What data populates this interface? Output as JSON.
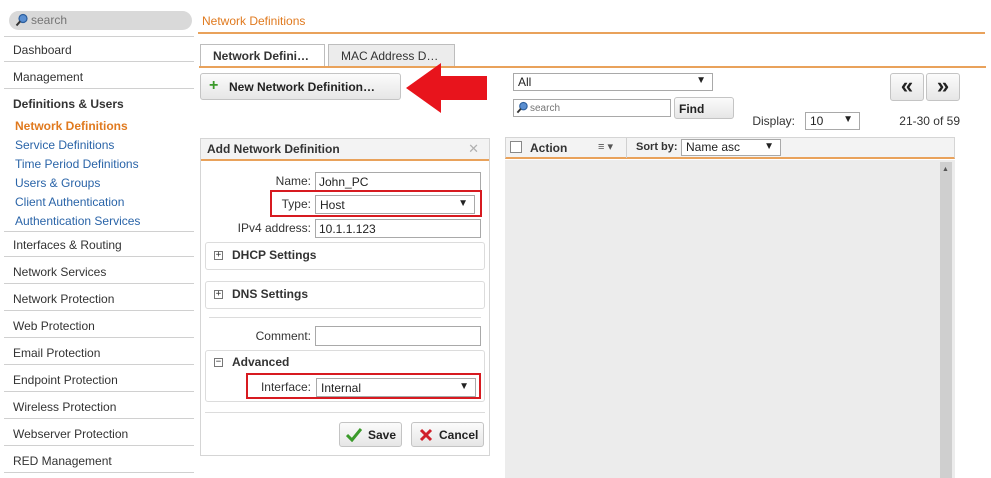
{
  "search": {
    "placeholder": "search"
  },
  "header": {
    "title": "Network Definitions"
  },
  "sidebar": {
    "dashboard": "Dashboard",
    "management": "Management",
    "definitions_users": "Definitions & Users",
    "sub_items": [
      "Network Definitions",
      "Service Definitions",
      "Time Period Definitions",
      "Users & Groups",
      "Client Authentication",
      "Authentication Services"
    ],
    "items": [
      "Interfaces & Routing",
      "Network Services",
      "Network Protection",
      "Web Protection",
      "Email Protection",
      "Endpoint Protection",
      "Wireless Protection",
      "Webserver Protection",
      "RED Management"
    ]
  },
  "tabs": [
    "Network Defini…",
    "MAC Address D…"
  ],
  "toolbar": {
    "new_button": "New Network Definition…",
    "new_icon": "plus-icon",
    "arrow_color": "#e8141c"
  },
  "filter": {
    "selected": "All",
    "search_placeholder": "search",
    "find_label": "Find",
    "display_label": "Display:",
    "display_value": "10",
    "range": "21-30 of 59",
    "prev": "«",
    "next": "»"
  },
  "form": {
    "title": "Add Network Definition",
    "name_label": "Name:",
    "name_value": "John_PC",
    "type_label": "Type:",
    "type_value": "Host",
    "ipv4_label": "IPv4 address:",
    "ipv4_value": "10.1.1.123",
    "dhcp_title": "DHCP Settings",
    "dns_title": "DNS Settings",
    "comment_label": "Comment:",
    "comment_value": "",
    "advanced_title": "Advanced",
    "interface_label": "Interface:",
    "interface_value": "Internal",
    "save_label": "Save",
    "cancel_label": "Cancel",
    "expand_symbol": "+",
    "collapse_symbol": "−",
    "close_symbol": "✕"
  },
  "list": {
    "action_label": "Action",
    "sortby_label": "Sort by:",
    "sortby_value": "Name asc"
  },
  "colors": {
    "accent": "#e07a1f",
    "link": "#2a64a8",
    "highlight": "#d71a20"
  }
}
